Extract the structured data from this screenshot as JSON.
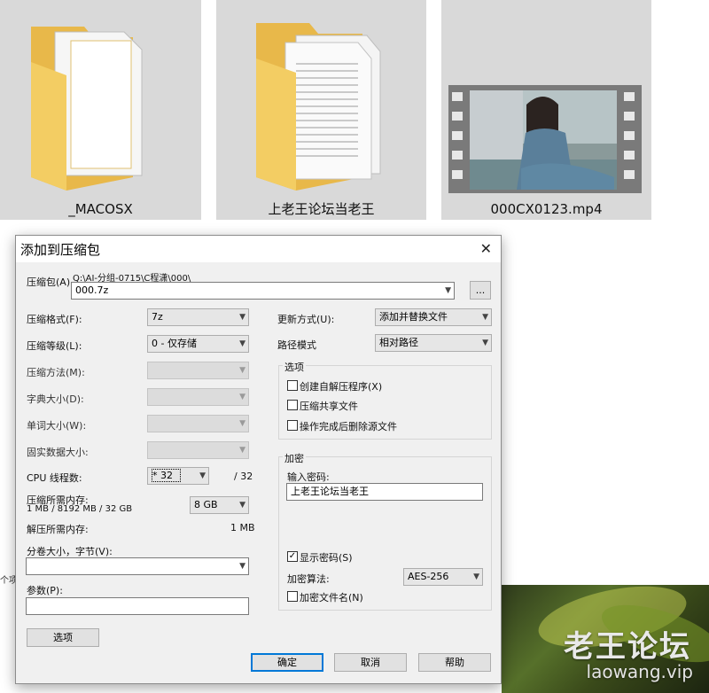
{
  "explorer": {
    "items": [
      {
        "name": "_MACOSX",
        "icon": "folder-icon"
      },
      {
        "name": "上老王论坛当老王",
        "icon": "folder-icon"
      },
      {
        "name": "000CX0123.mp4",
        "icon": "video-thumbnail"
      }
    ],
    "partial_text": "个项"
  },
  "watermark": {
    "cn": "老王论坛",
    "en": "laowang.vip"
  },
  "dialog": {
    "title": "添加到压缩包",
    "close_icon": "close-icon",
    "archive": {
      "label": "压缩包(A)",
      "path": "Q:\\AI-分组-0715\\C程潇\\000\\",
      "filename": "000.7z",
      "browse_label": "..."
    },
    "left": {
      "format_label": "压缩格式(F):",
      "format_value": "7z",
      "level_label": "压缩等级(L):",
      "level_value": "0 - 仅存储",
      "method_label": "压缩方法(M):",
      "dict_label": "字典大小(D):",
      "word_label": "单词大小(W):",
      "solid_label": "固实数据大小:",
      "threads_label": "CPU 线程数:",
      "threads_value": "* 32",
      "threads_max": "/ 32",
      "mem_comp_label": "压缩所需内存:",
      "mem_comp_detail": "1 MB / 8192 MB / 32 GB",
      "mem_comp_value": "8 GB",
      "mem_decomp_label": "解压所需内存:",
      "mem_decomp_value": "1 MB",
      "volume_label": "分卷大小，字节(V):",
      "params_label": "参数(P):",
      "options_button": "选项"
    },
    "right": {
      "update_label": "更新方式(U):",
      "update_value": "添加并替换文件",
      "path_label": "路径模式",
      "path_value": "相对路径",
      "options_group": "选项",
      "opt_sfx": "创建自解压程序(X)",
      "opt_shared": "压缩共享文件",
      "opt_delete": "操作完成后删除源文件",
      "encrypt_group": "加密",
      "password_label": "输入密码:",
      "password_value": "上老王论坛当老王",
      "show_password": "显示密码(S)",
      "method_label": "加密算法:",
      "method_value": "AES-256",
      "encrypt_names": "加密文件名(N)"
    },
    "buttons": {
      "ok": "确定",
      "cancel": "取消",
      "help": "帮助"
    }
  }
}
